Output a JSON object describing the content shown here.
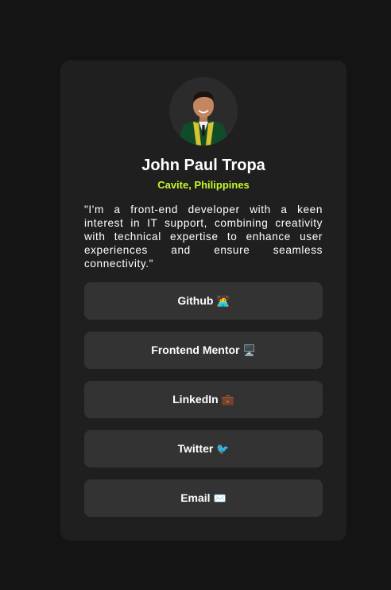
{
  "profile": {
    "name": "John Paul Tropa",
    "location": "Cavite, Philippines",
    "bio": "\"I'm a front-end developer with a keen interest in IT support, combining creativity with technical expertise to enhance user experiences and ensure seamless connectivity.\"",
    "avatar_icon": "graduation-portrait"
  },
  "links": [
    {
      "label": "Github",
      "emoji": "🧑‍💻"
    },
    {
      "label": "Frontend Mentor",
      "emoji": "🖥️"
    },
    {
      "label": "LinkedIn",
      "emoji": "💼"
    },
    {
      "label": "Twitter",
      "emoji": "🐦"
    },
    {
      "label": "Email",
      "emoji": "✉️"
    }
  ],
  "colors": {
    "page_bg": "#141414",
    "card_bg": "#1f1f1f",
    "button_bg": "#333333",
    "accent": "#c4f82a",
    "text": "#ffffff"
  }
}
